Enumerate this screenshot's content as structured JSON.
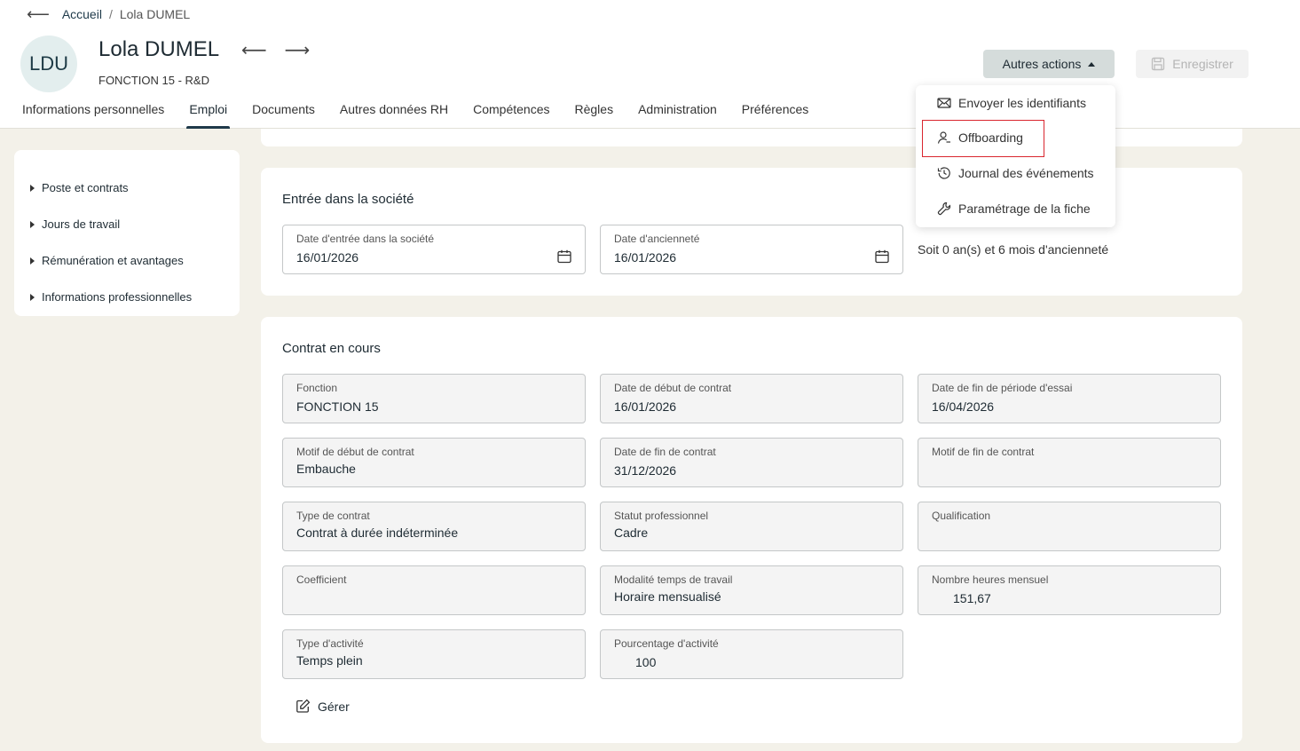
{
  "breadcrumb": {
    "home": "Accueil",
    "separator": "/",
    "current": "Lola DUMEL"
  },
  "employee": {
    "initials": "LDU",
    "name": "Lola DUMEL",
    "subtitle": "FONCTION 15 - R&D"
  },
  "header": {
    "actions_label": "Autres actions",
    "save_label": "Enregistrer"
  },
  "tabs": [
    {
      "label": "Informations personnelles"
    },
    {
      "label": "Emploi",
      "active": true
    },
    {
      "label": "Documents"
    },
    {
      "label": "Autres données RH"
    },
    {
      "label": "Compétences"
    },
    {
      "label": "Règles"
    },
    {
      "label": "Administration"
    },
    {
      "label": "Préférences"
    }
  ],
  "sidebar": {
    "items": [
      {
        "label": "Poste et contrats"
      },
      {
        "label": "Jours de travail"
      },
      {
        "label": "Rémunération et avantages"
      },
      {
        "label": "Informations professionnelles"
      }
    ]
  },
  "entry": {
    "title": "Entrée dans la société",
    "entry_date_label": "Date d'entrée dans la société",
    "entry_date": "16/01/2026",
    "seniority_date_label": "Date d'ancienneté",
    "seniority_date": "16/01/2026",
    "seniority_text": "Soit 0 an(s) et 6 mois d'ancienneté"
  },
  "contract": {
    "title": "Contrat en cours",
    "fields": [
      {
        "label": "Fonction",
        "value": "FONCTION 15"
      },
      {
        "label": "Date de début de contrat",
        "value": "16/01/2026"
      },
      {
        "label": "Date de fin de période d'essai",
        "value": "16/04/2026"
      },
      {
        "label": "Motif de début de contrat",
        "value": "Embauche"
      },
      {
        "label": "Date de fin de contrat",
        "value": "31/12/2026"
      },
      {
        "label": "Motif de fin de contrat",
        "value": ""
      },
      {
        "label": "Type de contrat",
        "value": "Contrat à durée indéterminée"
      },
      {
        "label": "Statut professionnel",
        "value": "Cadre"
      },
      {
        "label": "Qualification",
        "value": ""
      },
      {
        "label": "Coefficient",
        "value": ""
      },
      {
        "label": "Modalité temps de travail",
        "value": "Horaire mensualisé"
      },
      {
        "label": "Nombre heures mensuel",
        "value": "151,67"
      },
      {
        "label": "Type d'activité",
        "value": "Temps plein"
      },
      {
        "label": "Pourcentage d'activité",
        "value": "100"
      }
    ],
    "manage_label": "Gérer"
  },
  "menu": {
    "items": [
      {
        "label": "Envoyer les identifiants",
        "icon": "envelope-icon"
      },
      {
        "label": "Offboarding",
        "icon": "user-minus-icon",
        "highlighted": true
      },
      {
        "label": "Journal des événements",
        "icon": "history-icon"
      },
      {
        "label": "Paramétrage de la fiche",
        "icon": "wrench-icon"
      }
    ]
  },
  "colors": {
    "accent": "#1f3a4a",
    "highlight": "#d9262f",
    "background": "#f3f1e9"
  }
}
